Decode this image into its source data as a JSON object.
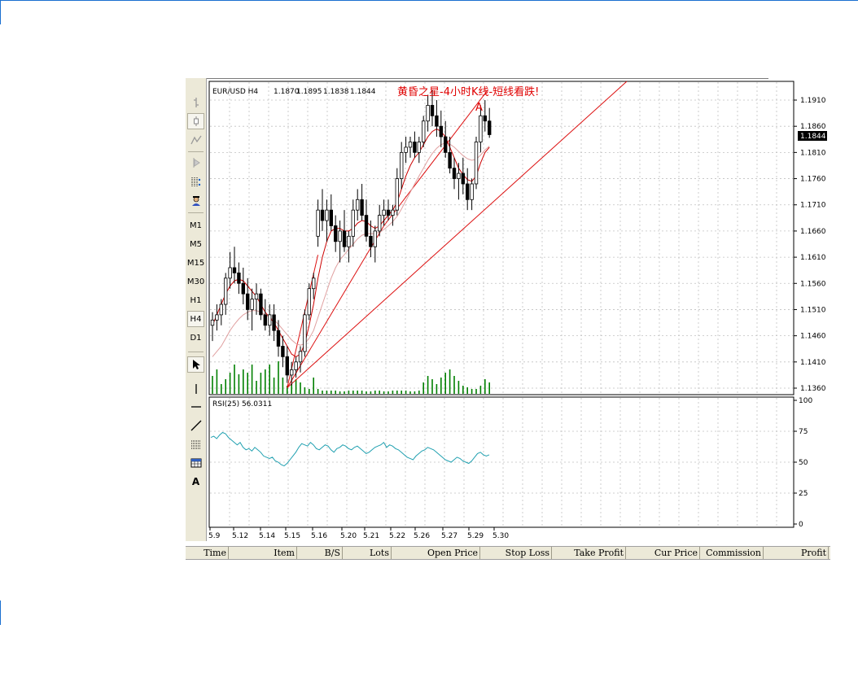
{
  "toolbar": {
    "timeframes": [
      "M1",
      "M5",
      "M15",
      "M30",
      "H1",
      "H4",
      "D1"
    ],
    "active_timeframe": "H4",
    "text_tool": "A"
  },
  "header": {
    "symbol": "EUR/USD H4",
    "open": "1.1870",
    "high": "1.1895",
    "low": "1.1838",
    "close": "1.1844",
    "annotation": "黄昏之星-4小时K线-短线看跌!",
    "pattern_marker": "A"
  },
  "current_price_label": "1.1844",
  "rsi_label": "RSI(25)  56.0311",
  "status_columns": [
    "Time",
    "Item",
    "B/S",
    "Lots",
    "Open Price",
    "Stop Loss",
    "Take Profit",
    "Cur Price",
    "Commission",
    "Profit"
  ],
  "colors": {
    "ma_fast": "#cc0000",
    "ma_slow": "#e0a0a0",
    "trendline": "#dd1111",
    "volume": "#008000",
    "rsi": "#20a0b0",
    "annotation": "#e00000",
    "grid": "#c0c0c0"
  },
  "chart_data": [
    {
      "type": "candlestick",
      "title": "EUR/USD H4",
      "x_ticks": [
        "5.9",
        "5.12",
        "5.14",
        "5.15",
        "5.16",
        "5.20",
        "5.21",
        "5.22",
        "5.26",
        "5.27",
        "5.29",
        "5.30"
      ],
      "y_ticks": [
        "1.1910",
        "1.1860",
        "1.1810",
        "1.1760",
        "1.1710",
        "1.1660",
        "1.1610",
        "1.1560",
        "1.1510",
        "1.1460",
        "1.1410",
        "1.1360"
      ],
      "ylim": [
        1.1345,
        1.1935
      ],
      "grid": true,
      "candles": [
        [
          1.148,
          1.1505,
          1.145,
          1.149
        ],
        [
          1.149,
          1.152,
          1.147,
          1.15
        ],
        [
          1.15,
          1.153,
          1.148,
          1.152
        ],
        [
          1.152,
          1.158,
          1.15,
          1.157
        ],
        [
          1.157,
          1.162,
          1.155,
          1.159
        ],
        [
          1.159,
          1.163,
          1.156,
          1.158
        ],
        [
          1.158,
          1.16,
          1.154,
          1.156
        ],
        [
          1.156,
          1.159,
          1.152,
          1.154
        ],
        [
          1.154,
          1.157,
          1.149,
          1.151
        ],
        [
          1.151,
          1.155,
          1.147,
          1.153
        ],
        [
          1.153,
          1.156,
          1.15,
          1.154
        ],
        [
          1.154,
          1.155,
          1.149,
          1.15
        ],
        [
          1.15,
          1.153,
          1.147,
          1.148
        ],
        [
          1.148,
          1.152,
          1.146,
          1.15
        ],
        [
          1.15,
          1.152,
          1.145,
          1.147
        ],
        [
          1.147,
          1.149,
          1.142,
          1.144
        ],
        [
          1.144,
          1.146,
          1.14,
          1.142
        ],
        [
          1.142,
          1.144,
          1.137,
          1.1385
        ],
        [
          1.1385,
          1.141,
          1.1365,
          1.1395
        ],
        [
          1.1395,
          1.142,
          1.138,
          1.141
        ],
        [
          1.141,
          1.144,
          1.139,
          1.143
        ],
        [
          1.143,
          1.151,
          1.142,
          1.15
        ],
        [
          1.15,
          1.156,
          1.149,
          1.155
        ],
        [
          1.155,
          1.158,
          1.153,
          1.157
        ],
        [
          1.165,
          1.172,
          1.163,
          1.17
        ],
        [
          1.17,
          1.174,
          1.166,
          1.168
        ],
        [
          1.168,
          1.172,
          1.164,
          1.17
        ],
        [
          1.17,
          1.173,
          1.166,
          1.167
        ],
        [
          1.167,
          1.169,
          1.162,
          1.164
        ],
        [
          1.164,
          1.168,
          1.16,
          1.166
        ],
        [
          1.166,
          1.17,
          1.162,
          1.163
        ],
        [
          1.163,
          1.166,
          1.16,
          1.165
        ],
        [
          1.165,
          1.172,
          1.163,
          1.17
        ],
        [
          1.17,
          1.174,
          1.168,
          1.172
        ],
        [
          1.172,
          1.175,
          1.168,
          1.169
        ],
        [
          1.169,
          1.172,
          1.164,
          1.165
        ],
        [
          1.165,
          1.168,
          1.161,
          1.163
        ],
        [
          1.163,
          1.167,
          1.16,
          1.166
        ],
        [
          1.166,
          1.171,
          1.165,
          1.169
        ],
        [
          1.169,
          1.172,
          1.167,
          1.17
        ],
        [
          1.17,
          1.172,
          1.168,
          1.169
        ],
        [
          1.169,
          1.171,
          1.167,
          1.17
        ],
        [
          1.17,
          1.178,
          1.169,
          1.176
        ],
        [
          1.176,
          1.183,
          1.174,
          1.181
        ],
        [
          1.181,
          1.184,
          1.179,
          1.182
        ],
        [
          1.182,
          1.184,
          1.18,
          1.183
        ],
        [
          1.183,
          1.185,
          1.18,
          1.181
        ],
        [
          1.181,
          1.184,
          1.179,
          1.183
        ],
        [
          1.183,
          1.188,
          1.182,
          1.187
        ],
        [
          1.187,
          1.192,
          1.185,
          1.19
        ],
        [
          1.19,
          1.193,
          1.186,
          1.188
        ],
        [
          1.188,
          1.191,
          1.184,
          1.186
        ],
        [
          1.186,
          1.189,
          1.182,
          1.184
        ],
        [
          1.184,
          1.187,
          1.18,
          1.181
        ],
        [
          1.181,
          1.184,
          1.177,
          1.178
        ],
        [
          1.178,
          1.18,
          1.174,
          1.176
        ],
        [
          1.176,
          1.179,
          1.172,
          1.177
        ],
        [
          1.177,
          1.18,
          1.173,
          1.175
        ],
        [
          1.175,
          1.178,
          1.17,
          1.172
        ],
        [
          1.172,
          1.176,
          1.17,
          1.175
        ],
        [
          1.175,
          1.184,
          1.174,
          1.183
        ],
        [
          1.183,
          1.19,
          1.181,
          1.188
        ],
        [
          1.188,
          1.191,
          1.185,
          1.187
        ],
        [
          1.187,
          1.1895,
          1.1838,
          1.1844
        ]
      ],
      "volume": [
        22,
        30,
        12,
        18,
        26,
        36,
        24,
        30,
        26,
        36,
        16,
        26,
        30,
        36,
        20,
        40,
        20,
        10,
        12,
        18,
        14,
        8,
        6,
        20,
        6,
        4,
        4,
        4,
        4,
        3,
        3,
        4,
        4,
        4,
        4,
        3,
        3,
        4,
        4,
        3,
        3,
        4,
        4,
        4,
        4,
        3,
        3,
        4,
        14,
        22,
        18,
        12,
        20,
        26,
        30,
        22,
        16,
        10,
        8,
        6,
        6,
        10,
        18,
        14
      ],
      "ma_fast": [
        1.148,
        1.15,
        1.152,
        1.154,
        1.1555,
        1.1565,
        1.1568,
        1.1565,
        1.1555,
        1.1545,
        1.1535,
        1.152,
        1.1505,
        1.1495,
        1.1485,
        1.147,
        1.1455,
        1.144,
        1.1425,
        1.142,
        1.1425,
        1.1445,
        1.148,
        1.152,
        1.157,
        1.161,
        1.164,
        1.166,
        1.1665,
        1.1665,
        1.166,
        1.166,
        1.1665,
        1.1675,
        1.168,
        1.1678,
        1.167,
        1.1665,
        1.167,
        1.168,
        1.169,
        1.17,
        1.1715,
        1.174,
        1.1765,
        1.1785,
        1.18,
        1.181,
        1.1825,
        1.184,
        1.185,
        1.1855,
        1.185,
        1.184,
        1.182,
        1.18,
        1.178,
        1.1768,
        1.1758,
        1.1755,
        1.1765,
        1.179,
        1.181,
        1.182
      ],
      "ma_slow": [
        1.142,
        1.143,
        1.144,
        1.1455,
        1.147,
        1.1482,
        1.1492,
        1.15,
        1.1505,
        1.1508,
        1.1508,
        1.1505,
        1.15,
        1.1495,
        1.149,
        1.1482,
        1.1472,
        1.1462,
        1.1452,
        1.1445,
        1.1442,
        1.1445,
        1.1455,
        1.147,
        1.1495,
        1.152,
        1.1545,
        1.157,
        1.159,
        1.1605,
        1.1615,
        1.1625,
        1.1635,
        1.1645,
        1.1652,
        1.1655,
        1.1655,
        1.1655,
        1.1658,
        1.1663,
        1.167,
        1.1678,
        1.1688,
        1.1702,
        1.1718,
        1.1734,
        1.175,
        1.1765,
        1.178,
        1.1795,
        1.1808,
        1.1818,
        1.1825,
        1.1828,
        1.1826,
        1.182,
        1.1812,
        1.1804,
        1.1798,
        1.1795,
        1.1797,
        1.1805,
        1.1815,
        1.1822
      ]
    },
    {
      "type": "line",
      "title": "RSI(25)",
      "y_ticks": [
        "100",
        "75",
        "50",
        "25",
        "0"
      ],
      "ylim": [
        0,
        100
      ],
      "values": [
        70,
        71,
        69,
        72,
        74,
        73,
        70,
        68,
        66,
        64,
        66,
        62,
        60,
        61,
        59,
        62,
        60,
        58,
        55,
        54,
        53,
        54,
        51,
        50,
        48,
        47,
        49,
        52,
        55,
        58,
        62,
        65,
        64,
        63,
        66,
        64,
        61,
        60,
        62,
        64,
        63,
        60,
        58,
        61,
        62,
        64,
        63,
        61,
        60,
        62,
        63,
        61,
        59,
        57,
        58,
        60,
        62,
        63,
        64,
        66,
        62,
        64,
        63,
        61,
        60,
        58,
        56,
        54,
        53,
        52,
        55,
        57,
        59,
        60,
        62,
        61,
        60,
        58,
        56,
        54,
        52,
        51,
        50,
        52,
        54,
        53,
        51,
        50,
        49,
        51,
        54,
        57,
        58,
        56,
        55,
        56
      ]
    }
  ]
}
